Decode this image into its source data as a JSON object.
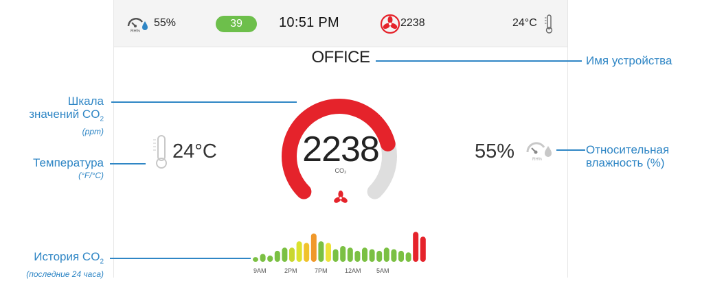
{
  "top_bar": {
    "humidity": "55%",
    "humidity_gauge_label": "RH%",
    "badge": "39",
    "clock": "10:51 PM",
    "fan_value": "2238",
    "temperature": "24°C"
  },
  "device": {
    "name": "OFFICE"
  },
  "main": {
    "temperature": "24°C",
    "co2_value": "2238",
    "co2_unit": "CO₂",
    "humidity": "55%",
    "humidity_gauge_label": "RH%"
  },
  "gauge": {
    "fill_fraction": 0.78,
    "fill_color": "#e5232b",
    "track_color": "#dedede"
  },
  "history": {
    "bars": [
      {
        "v": 0.15,
        "c": "#7bc043"
      },
      {
        "v": 0.25,
        "c": "#7bc043"
      },
      {
        "v": 0.2,
        "c": "#7bc043"
      },
      {
        "v": 0.35,
        "c": "#7bc043"
      },
      {
        "v": 0.45,
        "c": "#7bc043"
      },
      {
        "v": 0.45,
        "c": "#c9d730"
      },
      {
        "v": 0.65,
        "c": "#dbe22e"
      },
      {
        "v": 0.6,
        "c": "#f0c22c"
      },
      {
        "v": 0.9,
        "c": "#f0982a"
      },
      {
        "v": 0.65,
        "c": "#7bc043"
      },
      {
        "v": 0.6,
        "c": "#eee23a"
      },
      {
        "v": 0.4,
        "c": "#7bc043"
      },
      {
        "v": 0.5,
        "c": "#7bc043"
      },
      {
        "v": 0.45,
        "c": "#7bc043"
      },
      {
        "v": 0.35,
        "c": "#7bc043"
      },
      {
        "v": 0.45,
        "c": "#7bc043"
      },
      {
        "v": 0.4,
        "c": "#7bc043"
      },
      {
        "v": 0.35,
        "c": "#7bc043"
      },
      {
        "v": 0.45,
        "c": "#7bc043"
      },
      {
        "v": 0.4,
        "c": "#7bc043"
      },
      {
        "v": 0.35,
        "c": "#7bc043"
      },
      {
        "v": 0.3,
        "c": "#7bc043"
      },
      {
        "v": 0.95,
        "c": "#e5232b"
      },
      {
        "v": 0.8,
        "c": "#e5232b"
      }
    ],
    "ticks": [
      "9AM",
      "2PM",
      "7PM",
      "12AM",
      "5AM"
    ]
  },
  "callouts": {
    "device_name": "Имя устройства",
    "co2_scale_line1": "Шкала",
    "co2_scale_line2": "значений CO",
    "co2_scale_sub": "2",
    "co2_scale_unit": "(ppm)",
    "temperature": "Температура",
    "temperature_unit": "(°F/°C)",
    "humidity_line1": "Относительная",
    "humidity_line2": "влажность (%)",
    "history": "История CO",
    "history_sub": "2",
    "history_note": "(последние 24 часа)"
  },
  "colors": {
    "accent_red": "#e5232b",
    "callout_blue": "#2f86c5",
    "badge_green": "#6dbf4b",
    "droplet_blue": "#2f86c5"
  },
  "icons": [
    "humidity-gauge-icon",
    "fan-icon",
    "thermometer-icon"
  ]
}
